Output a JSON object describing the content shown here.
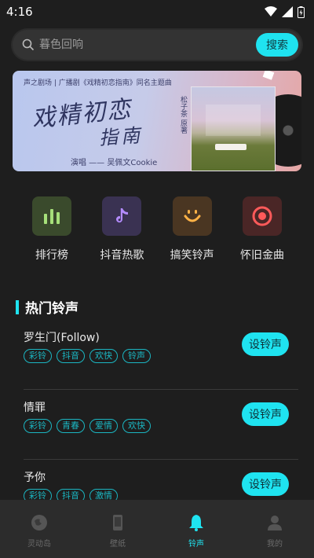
{
  "status": {
    "time": "4:16"
  },
  "search": {
    "placeholder": "暮色回响",
    "button_label": "搜索"
  },
  "banner": {
    "topline": "声之剧场 | 广播剧《戏精初恋指南》同名主题曲",
    "calligraphy_line1": "戏精初恋",
    "calligraphy_line2": "指南",
    "singer_label": "演唱 —— 吴佩文Cookie",
    "vertical_text": "松子茶 原著"
  },
  "categories": [
    {
      "label": "排行榜",
      "icon": "bar-chart-icon",
      "color": "#a6e07a",
      "bg": "#3a4a2c"
    },
    {
      "label": "抖音热歌",
      "icon": "tiktok-note-icon",
      "color": "#b48cff",
      "bg": "#3a3252"
    },
    {
      "label": "搞笑铃声",
      "icon": "smile-icon",
      "color": "#ffb246",
      "bg": "#4a3622"
    },
    {
      "label": "怀旧金曲",
      "icon": "target-icon",
      "color": "#ff5a5a",
      "bg": "#4a2626"
    }
  ],
  "section": {
    "title": "热门铃声"
  },
  "songs": [
    {
      "name": "罗生门(Follow)",
      "tags": [
        "彩铃",
        "抖音",
        "欢快",
        "铃声"
      ],
      "button": "设铃声"
    },
    {
      "name": "情罪",
      "tags": [
        "彩铃",
        "青春",
        "爱情",
        "欢快"
      ],
      "button": "设铃声"
    },
    {
      "name": "予你",
      "tags": [
        "彩铃",
        "抖音",
        "激情"
      ],
      "button": "设铃声"
    }
  ],
  "nav": [
    {
      "label": "灵动岛",
      "icon": "island-icon"
    },
    {
      "label": "壁纸",
      "icon": "phone-wallpaper-icon"
    },
    {
      "label": "铃声",
      "icon": "bell-icon"
    },
    {
      "label": "我的",
      "icon": "user-icon"
    }
  ],
  "colors": {
    "accent": "#1fe3f0",
    "background": "#1e1e1e"
  }
}
